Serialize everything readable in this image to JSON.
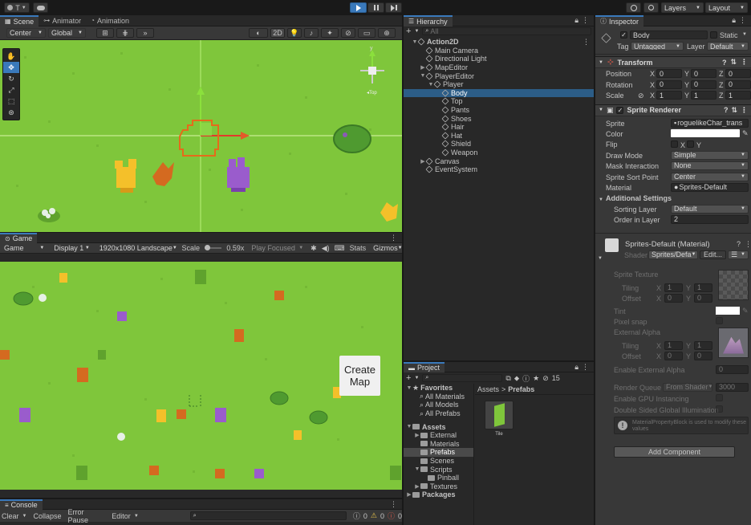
{
  "toolbar": {
    "account": "T",
    "layers_label": "Layers",
    "layout_label": "Layout"
  },
  "scene": {
    "tabs": [
      "Scene",
      "Animator",
      "Animation"
    ],
    "pivot": "Center",
    "space": "Global",
    "mode_2d": "2D",
    "tool_handles": [
      "hand",
      "move",
      "rotate",
      "scale",
      "rect",
      "transform"
    ]
  },
  "game": {
    "tab": "Game",
    "view": "Game",
    "display": "Display 1",
    "resolution": "1920x1080 Landscape",
    "scale_label": "Scale",
    "scale_value": "0.59x",
    "play_focused": "Play Focused",
    "stats": "Stats",
    "gizmos": "Gizmos",
    "create_map_button": "Create\nMap"
  },
  "hierarchy": {
    "tab": "Hierarchy",
    "search_placeholder": "All",
    "items": [
      {
        "label": "Action2D",
        "depth": 0,
        "caret": "▼",
        "scene": true
      },
      {
        "label": "Main Camera",
        "depth": 1,
        "caret": ""
      },
      {
        "label": "Directional Light",
        "depth": 1,
        "caret": ""
      },
      {
        "label": "MapEditor",
        "depth": 1,
        "caret": "▶"
      },
      {
        "label": "PlayerEditor",
        "depth": 1,
        "caret": "▼"
      },
      {
        "label": "Player",
        "depth": 2,
        "caret": "▼"
      },
      {
        "label": "Body",
        "depth": 3,
        "caret": "",
        "selected": true
      },
      {
        "label": "Top",
        "depth": 3,
        "caret": ""
      },
      {
        "label": "Pants",
        "depth": 3,
        "caret": ""
      },
      {
        "label": "Shoes",
        "depth": 3,
        "caret": ""
      },
      {
        "label": "Hair",
        "depth": 3,
        "caret": ""
      },
      {
        "label": "Hat",
        "depth": 3,
        "caret": ""
      },
      {
        "label": "Shield",
        "depth": 3,
        "caret": ""
      },
      {
        "label": "Weapon",
        "depth": 3,
        "caret": ""
      },
      {
        "label": "Canvas",
        "depth": 1,
        "caret": "▶"
      },
      {
        "label": "EventSystem",
        "depth": 1,
        "caret": ""
      }
    ]
  },
  "project": {
    "tab": "Project",
    "count": "15",
    "favorites_label": "Favorites",
    "favorites": [
      "All Materials",
      "All Models",
      "All Prefabs"
    ],
    "assets_label": "Assets",
    "assets": [
      {
        "label": "External",
        "depth": 1,
        "caret": "▶"
      },
      {
        "label": "Materials",
        "depth": 1,
        "caret": ""
      },
      {
        "label": "Prefabs",
        "depth": 1,
        "caret": "",
        "selected": true
      },
      {
        "label": "Scenes",
        "depth": 1,
        "caret": ""
      },
      {
        "label": "Scripts",
        "depth": 1,
        "caret": "▼"
      },
      {
        "label": "Pinball",
        "depth": 2,
        "caret": ""
      },
      {
        "label": "Textures",
        "depth": 1,
        "caret": "▶"
      }
    ],
    "packages_label": "Packages",
    "breadcrumb_root": "Assets",
    "breadcrumb_sep": ">",
    "breadcrumb_current": "Prefabs",
    "asset_tile_label": "Tile"
  },
  "console": {
    "tab": "Console",
    "clear": "Clear",
    "collapse": "Collapse",
    "error_pause": "Error Pause",
    "editor": "Editor",
    "counts": [
      "0",
      "0",
      "0"
    ]
  },
  "inspector": {
    "tab": "Inspector",
    "object_name": "Body",
    "static_label": "Static",
    "tag_label": "Tag",
    "tag_value": "Untagged",
    "layer_label": "Layer",
    "layer_value": "Default",
    "transform": {
      "title": "Transform",
      "position_label": "Position",
      "rotation_label": "Rotation",
      "scale_label": "Scale",
      "position": [
        "0",
        "0",
        "0"
      ],
      "rotation": [
        "0",
        "0",
        "0"
      ],
      "scale": [
        "1",
        "1",
        "1"
      ]
    },
    "sprite_renderer": {
      "title": "Sprite Renderer",
      "sprite_label": "Sprite",
      "sprite_value": "roguelikeChar_trans",
      "color_label": "Color",
      "flip_label": "Flip",
      "flip_x": "X",
      "flip_y": "Y",
      "draw_mode_label": "Draw Mode",
      "draw_mode_value": "Simple",
      "mask_label": "Mask Interaction",
      "mask_value": "None",
      "sort_point_label": "Sprite Sort Point",
      "sort_point_value": "Center",
      "material_label": "Material",
      "material_value": "Sprites-Default",
      "additional_label": "Additional Settings",
      "sorting_layer_label": "Sorting Layer",
      "sorting_layer_value": "Default",
      "order_label": "Order in Layer",
      "order_value": "2"
    },
    "material": {
      "title": "Sprites-Default (Material)",
      "shader_label": "Shader",
      "shader_value": "Sprites/Defa",
      "edit_label": "Edit...",
      "sprite_texture": "Sprite Texture",
      "tiling": "Tiling",
      "offset": "Offset",
      "tint": "Tint",
      "pixel_snap": "Pixel snap",
      "external_alpha": "External Alpha",
      "enable_external_alpha": "Enable External Alpha",
      "enable_external_alpha_value": "0",
      "render_queue": "Render Queue",
      "render_queue_mode": "From Shader",
      "render_queue_value": "3000",
      "gpu_instancing": "Enable GPU Instancing",
      "double_sided": "Double Sided Global Illumination",
      "info": "MaterialPropertyBlock is used to modify these values",
      "tiling1": [
        "1",
        "1"
      ],
      "offset1": [
        "0",
        "0"
      ],
      "tiling2": [
        "1",
        "1"
      ],
      "offset2": [
        "0",
        "0"
      ]
    },
    "add_component": "Add Component"
  },
  "colors": {
    "grass": "#7fc63b",
    "accent_blue": "#2c5d87",
    "play_blue": "#3a79bb"
  }
}
